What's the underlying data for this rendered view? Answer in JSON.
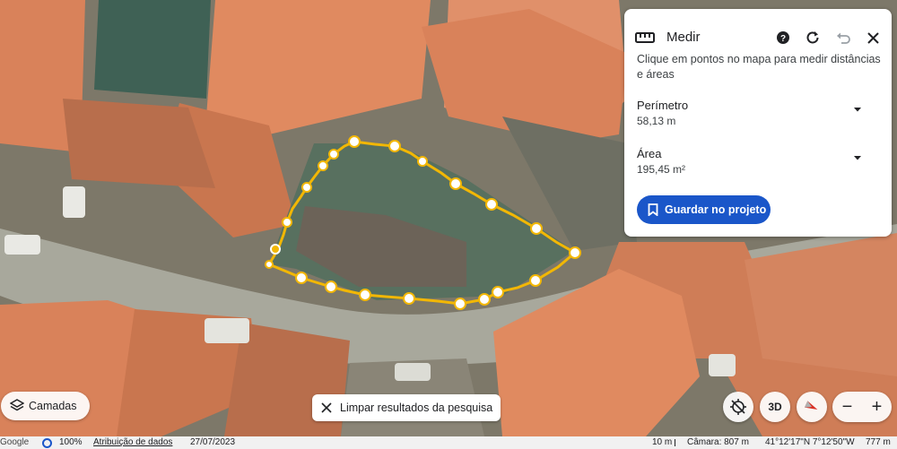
{
  "measure_panel": {
    "title": "Medir",
    "description": "Clique em pontos no mapa para medir distâncias e áreas",
    "perimeter_label": "Perímetro",
    "perimeter_value": "58,13 m",
    "area_label": "Área",
    "area_value": "195,45 m²",
    "save_label": "Guardar no projeto",
    "icons": [
      "ruler-icon",
      "help-icon",
      "refresh-icon",
      "undo-icon",
      "close-icon",
      "chevron-down-icon",
      "bookmark-icon"
    ]
  },
  "layers_button": {
    "label": "Camadas",
    "icon": "layers-icon"
  },
  "clear_search_button": {
    "label": "Limpar resultados da pesquisa",
    "icon": "close-icon"
  },
  "map_controls": {
    "view_3d_label": "3D",
    "zoom_out_label": "−",
    "zoom_in_label": "+"
  },
  "status_bar": {
    "logo": "Google",
    "zoom": "100%",
    "attribution_link": "Atribuição de dados",
    "imagery_date": "27/07/2023",
    "scale": "10 m",
    "camera": "Câmara: 807 m",
    "coordinates": "41°12'17\"N 7°12'50\"W",
    "elevation": "777 m"
  },
  "colors": {
    "accent": "#1a56c9",
    "measure_line": "#f2b705",
    "roof": "#d9825a"
  }
}
